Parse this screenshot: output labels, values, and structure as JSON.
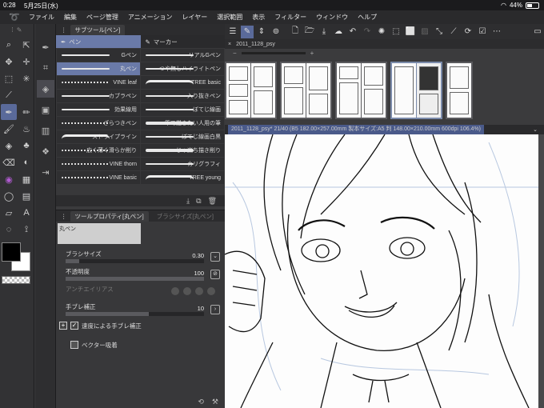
{
  "status": {
    "time": "0:28",
    "date": "5月25日(水)",
    "battery": "44%"
  },
  "menu": [
    "ファイル",
    "編集",
    "ページ管理",
    "アニメーション",
    "レイヤー",
    "選択範囲",
    "表示",
    "フィルター",
    "ウィンドウ",
    "ヘルプ"
  ],
  "subtool": {
    "title": "サブツール[ペン]",
    "groups": [
      "ペン",
      "マーカー"
    ],
    "brushes": [
      [
        "Gペン",
        "リアルGペン"
      ],
      [
        "丸ペン",
        "つや無しハイライトペン"
      ],
      [
        "VINE leaf",
        "TREE basic"
      ],
      [
        "カブラペン",
        "入り抜きペン"
      ],
      [
        "効果線用",
        "ぼてじ線画"
      ],
      [
        "ざらつきペン",
        "筆で描きたい人用の筆"
      ],
      [
        "ストライプライン",
        "ぼてじ線画白黒"
      ],
      [
        "広く薄く滑らか削り",
        "じゃ楽ち描き削り"
      ],
      [
        "VINE thorn",
        "カリグラフィ"
      ],
      [
        "VINE basic",
        "TREE young"
      ]
    ],
    "selected": "丸ペン"
  },
  "toolprop": {
    "title": "ツールプロパティ[丸ペン]",
    "tab2": "ブラシサイズ[丸ペン]",
    "preview_label": "丸ペン",
    "brush_size_label": "ブラシサイズ",
    "brush_size": "0.30",
    "opacity_label": "不透明度",
    "opacity": "100",
    "antialias_label": "アンチエイリアス",
    "stabilize_label": "手ブレ補正",
    "stabilize": "10",
    "speed_stab_label": "速度による手ブレ補正",
    "vector_label": "ベクター吸着"
  },
  "pagemgr": {
    "tab": "2011_1128_psy"
  },
  "canvas": {
    "tab": "2011_1128_psy* 21/40 (B5 182.00×257.00mm 製本サイズ:A5 判 148.00×210.00mm 600dpi 106.4%)"
  },
  "colors": {
    "accent": "#6a7aa8",
    "panel": "#38383a",
    "main_color": "#000000",
    "sub_color": "#ffffff"
  }
}
